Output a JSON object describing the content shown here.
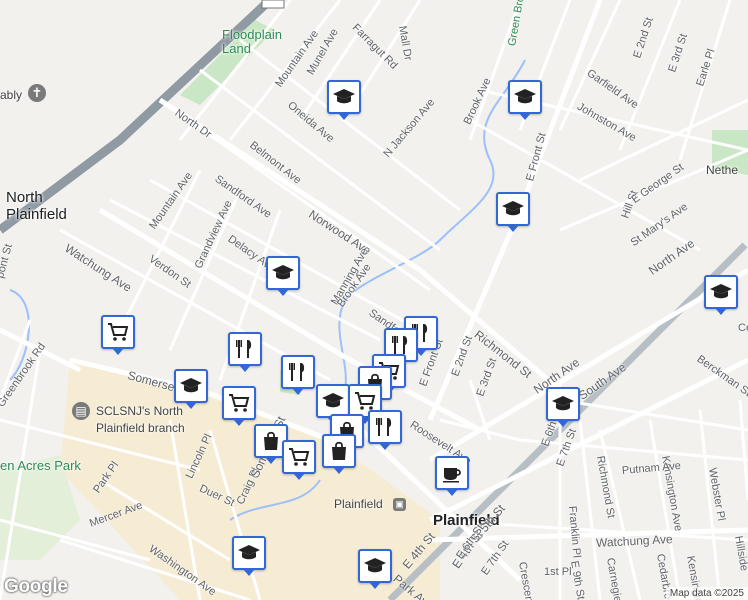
{
  "map": {
    "places": {
      "north_plainfield": "North\nPlainfield",
      "plainfield": "Plainfield",
      "floodplain": "Floodplain\nLand",
      "library": "SCLSNJ's North\nPlainfield branch",
      "station": "Plainfield",
      "park": "en Acres Park",
      "church_fragment": "ably",
      "green_brook": "Green Brook",
      "nether": "Nethe"
    },
    "streets": [
      "Mountain Ave",
      "Munel Ave",
      "Farragut Rd",
      "Mall Dr",
      "Oneida Ave",
      "North Dr",
      "Belmont Ave",
      "N Jackson Ave",
      "Brook Ave",
      "Garfield Ave",
      "Johnston Ave",
      "E 2nd St",
      "E 3rd St",
      "Earle Pl",
      "E Front St",
      "Hill St",
      "E George St",
      "St Mary's Ave",
      "North Ave",
      "Sandford Ave",
      "Norwood Ave",
      "Mountain Ave",
      "Grandview Ave",
      "Delacy Ave",
      "Verdon St",
      "Watchung Ave",
      "Manning Ave",
      "Brook Ave",
      "Sandford",
      "Richmond St",
      "E Front St",
      "E 2nd St",
      "E 3rd St",
      "North Ave",
      "South Ave",
      "Berckman St",
      "Kensington Ave",
      "Webster Pl",
      "Greenbrook Rd",
      "Somerset St",
      "Roosevelt Ave",
      "E 4th St",
      "E 5th St",
      "E 6th St",
      "E 7th St",
      "Richmond St",
      "Putnam Ave",
      "Lincoln Pl",
      "Duer St",
      "Craig Pl",
      "Somerset St",
      "Park Pl",
      "Mercer Ave",
      "Washington Ave",
      "Watchung Ave",
      "Franklin Pl",
      "Carnegie Ave",
      "E 9th St",
      "1st Pl",
      "Crescent Ave",
      "E 4th St",
      "E 6th St",
      "E 7th St",
      "Park Ave",
      "Cedarbrook",
      "Kensington",
      "pont St",
      "Hillside",
      "Cent"
    ],
    "poi_icons": [
      "graduation-cap-icon",
      "graduation-cap-icon",
      "graduation-cap-icon",
      "graduation-cap-icon",
      "graduation-cap-icon",
      "graduation-cap-icon",
      "graduation-cap-icon",
      "graduation-cap-icon",
      "graduation-cap-icon",
      "restaurant-icon",
      "restaurant-icon",
      "restaurant-icon",
      "restaurant-icon",
      "restaurant-icon",
      "shopping-cart-icon",
      "shopping-cart-icon",
      "shopping-cart-icon",
      "shopping-cart-icon",
      "shopping-bag-icon",
      "shopping-bag-icon",
      "shopping-bag-icon",
      "coffee-cup-icon"
    ],
    "colors": {
      "pin_border": "#3367d6",
      "road_major": "#ffffff",
      "highway": "#8f9aa3",
      "park": "#c9e7c4",
      "water": "#9cc0f9",
      "downtown": "#f6ecd4"
    },
    "logo": "Google",
    "credit": "Map data ©2025"
  }
}
